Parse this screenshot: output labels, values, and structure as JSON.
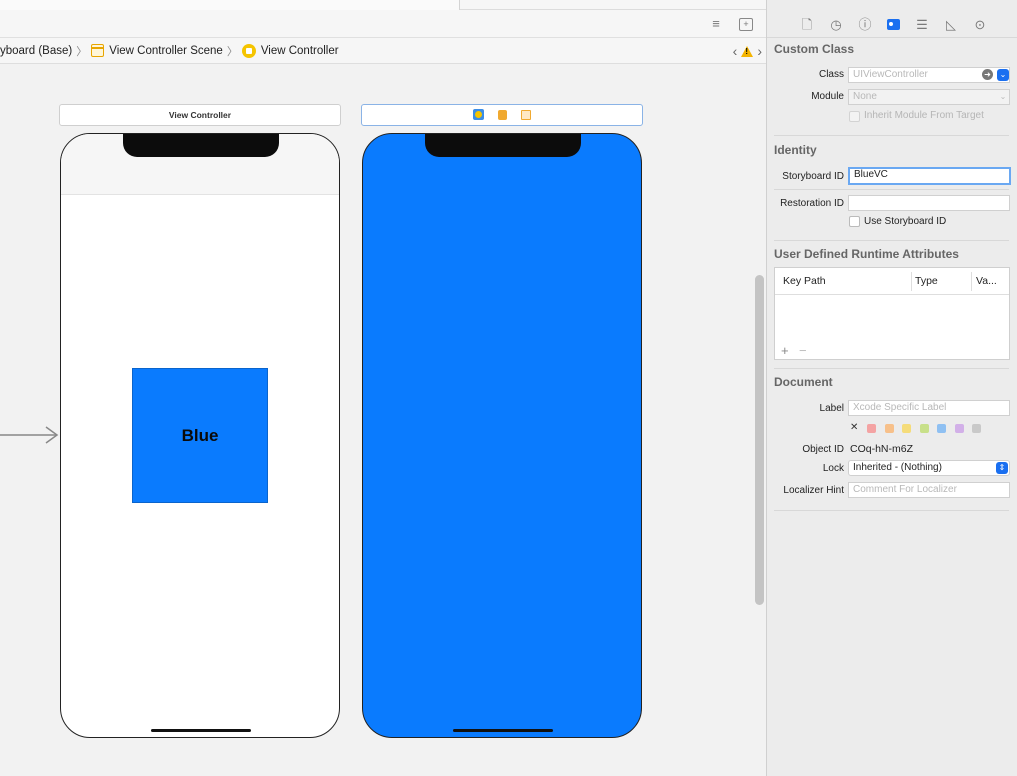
{
  "jumpbar": {
    "crumb1": "yboard (Base)",
    "crumb2": "View Controller Scene",
    "crumb3": "View Controller"
  },
  "canvas": {
    "scene1_title": "View Controller",
    "blue_view_label": "Blue",
    "blue_color": "#0a7bfe"
  },
  "inspector": {
    "custom_class": {
      "title": "Custom Class",
      "class_label": "Class",
      "class_placeholder": "UIViewController",
      "module_label": "Module",
      "module_value": "None",
      "inherit_label": "Inherit Module From Target"
    },
    "identity": {
      "title": "Identity",
      "storyboard_id_label": "Storyboard ID",
      "storyboard_id_value": "BlueVC",
      "restoration_id_label": "Restoration ID",
      "restoration_id_value": "",
      "use_storyboard_id_label": "Use Storyboard ID"
    },
    "runtime_attrs": {
      "title": "User Defined Runtime Attributes",
      "col_keypath": "Key Path",
      "col_type": "Type",
      "col_value": "Va...",
      "add": "+",
      "remove": "−"
    },
    "document": {
      "title": "Document",
      "label_label": "Label",
      "label_placeholder": "Xcode Specific Label",
      "clear": "✕",
      "swatches": [
        "#f4a3a3",
        "#f7c08a",
        "#f5dc7a",
        "#c8e08a",
        "#8fc0f2",
        "#d2b0e8",
        "#c9c9c9"
      ],
      "object_id_label": "Object ID",
      "object_id_value": "COq-hN-m6Z",
      "lock_label": "Lock",
      "lock_value": "Inherited - (Nothing)",
      "localizer_label": "Localizer Hint",
      "localizer_placeholder": "Comment For Localizer"
    }
  }
}
